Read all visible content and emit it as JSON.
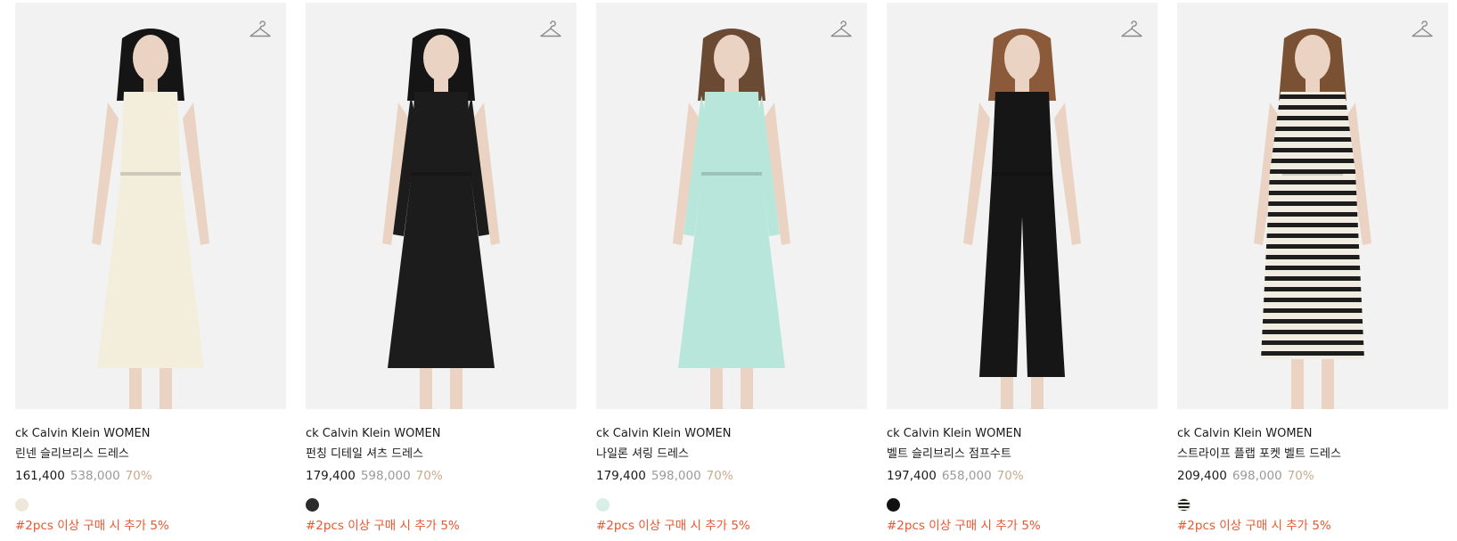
{
  "products": [
    {
      "brand": "ck Calvin Klein WOMEN",
      "name": "린넨 슬리브리스 드레스",
      "price": "161,400",
      "original_price": "538,000",
      "discount": "70%",
      "swatch": "#efe7da",
      "promo": "#2pcs 이상 구매 시 추가 5%",
      "garment": "#f3eedc",
      "hair": "#151515"
    },
    {
      "brand": "ck Calvin Klein WOMEN",
      "name": "펀칭 디테일 셔츠 드레스",
      "price": "179,400",
      "original_price": "598,000",
      "discount": "70%",
      "swatch": "#2b2b2b",
      "promo": "#2pcs 이상 구매 시 추가 5%",
      "garment": "#1c1c1c",
      "hair": "#151515"
    },
    {
      "brand": "ck Calvin Klein WOMEN",
      "name": "나일론 셔링 드레스",
      "price": "179,400",
      "original_price": "598,000",
      "discount": "70%",
      "swatch": "#d8efe8",
      "promo": "#2pcs 이상 구매 시 추가 5%",
      "garment": "#b9e6da",
      "hair": "#6b4a34"
    },
    {
      "brand": "ck Calvin Klein WOMEN",
      "name": "벨트 슬리브리스 점프수트",
      "price": "197,400",
      "original_price": "658,000",
      "discount": "70%",
      "swatch": "#111111",
      "promo": "#2pcs 이상 구매 시 추가 5%",
      "garment": "#161616",
      "hair": "#8a5a3a"
    },
    {
      "brand": "ck Calvin Klein WOMEN",
      "name": "스트라이프 플랩 포켓 벨트 드레스",
      "price": "209,400",
      "original_price": "698,000",
      "discount": "70%",
      "swatch": "stripe",
      "promo": "#2pcs 이상 구매 시 추가 5%",
      "garment": "stripe",
      "hair": "#7a5233"
    }
  ],
  "icons": {
    "wishlist": "hanger-icon"
  },
  "colors": {
    "promo": "#e8562f",
    "discount": "#c9a98d",
    "original_price": "#9a9a9a",
    "image_bg": "#f2f2f2"
  }
}
